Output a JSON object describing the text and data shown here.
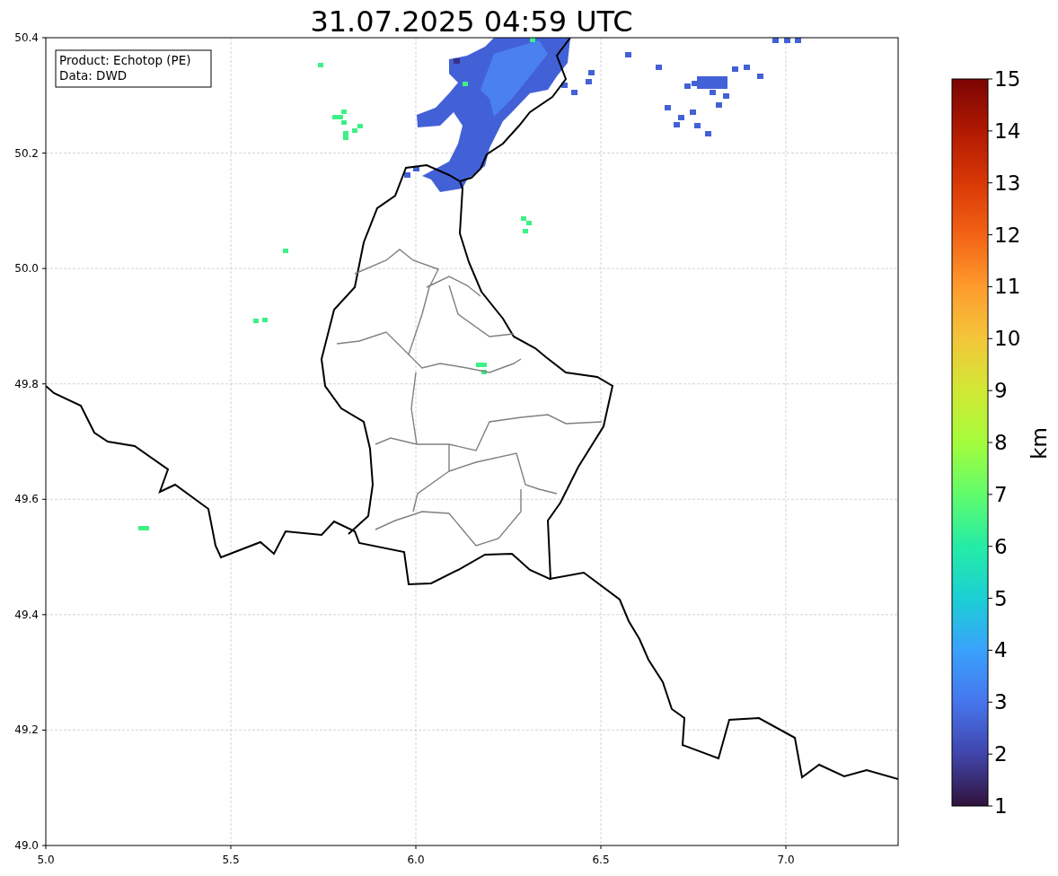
{
  "title": "31.07.2025 04:59 UTC",
  "map": {
    "info_box": [
      "Product: Echotop (PE)",
      "Data: DWD"
    ],
    "x_ticks": [
      "5.0",
      "5.5",
      "6.0",
      "6.5",
      "7.0"
    ],
    "y_ticks": [
      "50.4",
      "50.2",
      "50.0",
      "49.8",
      "49.6",
      "49.4",
      "49.2",
      "49.0"
    ]
  },
  "colorbar": {
    "label": "km",
    "ticks": [
      "15",
      "14",
      "13",
      "12",
      "11",
      "10",
      "9",
      "8",
      "7",
      "6",
      "5",
      "4",
      "3",
      "2",
      "1"
    ]
  }
}
